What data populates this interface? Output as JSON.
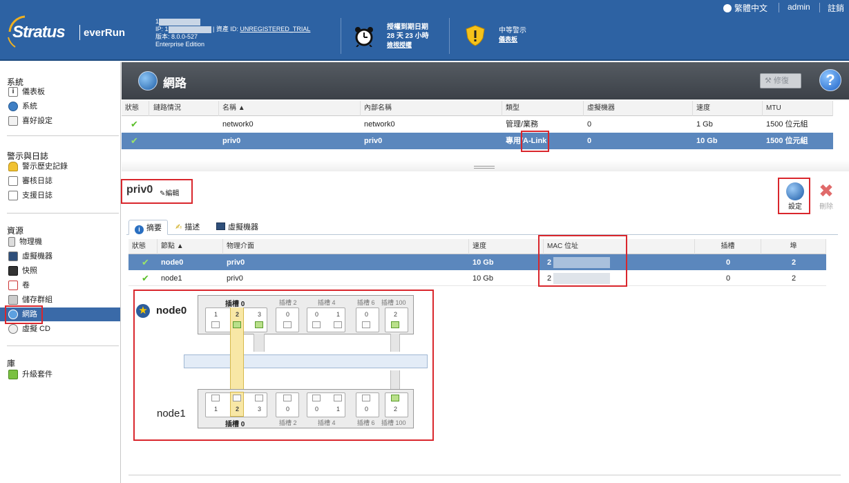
{
  "header": {
    "brand": "Stratus",
    "product": "everRun",
    "line1_prefix": "1",
    "ip_prefix": "IP: 1",
    "asset_label": "資產 ID:",
    "asset_value": "UNREGISTERED_TRIAL",
    "version": "版本: 8.0.0-527",
    "edition": "Enterprise Edition",
    "license_title": "授權到期日期",
    "license_days": "28 天 23 小時",
    "license_link": "檢視授權",
    "alert_title": "中等警示",
    "alert_link": "儀表板",
    "language": "繁體中文",
    "user": "admin",
    "logout": "註銷",
    "colors": {
      "header_bg": "#2d62a3",
      "selection": "#5b87bd",
      "highlight": "#d9262c"
    }
  },
  "sidebar": {
    "groups": [
      {
        "title": "系統",
        "items": [
          {
            "label": "儀表板",
            "icon": "info-icon"
          },
          {
            "label": "系統",
            "icon": "globe-icon"
          },
          {
            "label": "喜好設定",
            "icon": "preferences-icon"
          }
        ]
      },
      {
        "title": "警示與日誌",
        "items": [
          {
            "label": "警示歷史記錄",
            "icon": "bell-icon"
          },
          {
            "label": "審核日誌",
            "icon": "calendar-icon"
          },
          {
            "label": "支援日誌",
            "icon": "support-log-icon"
          }
        ]
      },
      {
        "title": "資源",
        "items": [
          {
            "label": "物理機",
            "icon": "server-icon"
          },
          {
            "label": "虛擬機器",
            "icon": "vm-icon"
          },
          {
            "label": "快照",
            "icon": "camera-icon"
          },
          {
            "label": "卷",
            "icon": "volume-icon"
          },
          {
            "label": "儲存群組",
            "icon": "storage-icon"
          },
          {
            "label": "網路",
            "icon": "network-icon"
          },
          {
            "label": "虛擬 CD",
            "icon": "cd-icon"
          }
        ]
      },
      {
        "title": "庫",
        "items": [
          {
            "label": "升級套件",
            "icon": "upgrade-icon"
          }
        ]
      }
    ]
  },
  "page": {
    "title": "網路",
    "repair_button": "修復",
    "help_icon": "help-icon"
  },
  "network_table": {
    "columns": [
      "狀態",
      "鏈路情況",
      "名稱 ▲",
      "內部名稱",
      "類型",
      "虛擬機器",
      "速度",
      "MTU"
    ],
    "rows": [
      {
        "status": "✔",
        "link": "",
        "name": "network0",
        "internal": "network0",
        "type": "管理/業務",
        "vms": "0",
        "speed": "1 Gb",
        "mtu": "1500 位元組"
      },
      {
        "status": "✔",
        "link": "",
        "name": "priv0",
        "internal": "priv0",
        "type": "專用/A-Link",
        "vms": "0",
        "speed": "10 Gb",
        "mtu": "1500 位元組"
      }
    ]
  },
  "detail": {
    "name": "priv0",
    "edit_label": "編輯",
    "config_label": "設定",
    "delete_label": "刪除",
    "tabs": [
      "摘要",
      "描述",
      "虛擬機器"
    ],
    "columns": [
      "狀態",
      "節點 ▲",
      "物理介面",
      "速度",
      "MAC 位址",
      "插槽",
      "埠"
    ],
    "rows": [
      {
        "status": "✔",
        "node": "node0",
        "iface": "priv0",
        "speed": "10 Gb",
        "mac": "2",
        "slot": "0",
        "port": "2"
      },
      {
        "status": "✔",
        "node": "node1",
        "iface": "priv0",
        "speed": "10 Gb",
        "mac": "2",
        "slot": "0",
        "port": "2"
      }
    ]
  },
  "diagram": {
    "node0_label": "node0",
    "node1_label": "node1",
    "slot_prefix": "插槽",
    "slot_labels": [
      "插槽 0",
      "插槽 2",
      "插槽 4",
      "插槽 6",
      "插槽 100"
    ],
    "top_ports": [
      "1",
      "2",
      "3",
      "0",
      "0",
      "1",
      "0",
      "2"
    ],
    "bottom_ports": [
      "1",
      "2",
      "3",
      "0",
      "0",
      "1",
      "0",
      "2"
    ]
  }
}
